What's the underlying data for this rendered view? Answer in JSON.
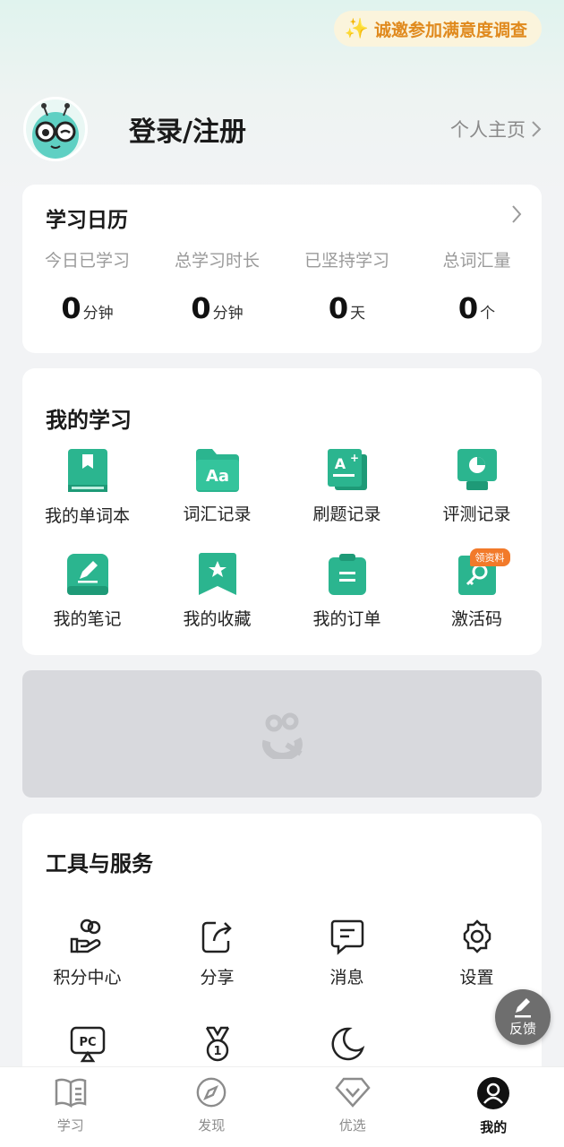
{
  "survey": {
    "label": "诚邀参加满意度调查",
    "icon": "sparkle-icon"
  },
  "profile": {
    "login_label": "登录/注册",
    "homepage_label": "个人主页"
  },
  "calendar": {
    "title": "学习日历",
    "stats": [
      {
        "label": "今日已学习",
        "value": "0",
        "unit": "分钟"
      },
      {
        "label": "总学习时长",
        "value": "0",
        "unit": "分钟"
      },
      {
        "label": "已坚持学习",
        "value": "0",
        "unit": "天"
      },
      {
        "label": "总词汇量",
        "value": "0",
        "unit": "个"
      }
    ]
  },
  "study": {
    "title": "我的学习",
    "items": [
      {
        "label": "我的单词本",
        "icon": "wordbook-icon"
      },
      {
        "label": "词汇记录",
        "icon": "vocab-folder-icon"
      },
      {
        "label": "刷题记录",
        "icon": "exercise-record-icon"
      },
      {
        "label": "评测记录",
        "icon": "assessment-icon"
      },
      {
        "label": "我的笔记",
        "icon": "notes-icon"
      },
      {
        "label": "我的收藏",
        "icon": "favorites-icon"
      },
      {
        "label": "我的订单",
        "icon": "orders-icon"
      },
      {
        "label": "激活码",
        "icon": "activation-key-icon",
        "badge": "领资料"
      }
    ]
  },
  "tools": {
    "title": "工具与服务",
    "items": [
      {
        "label": "积分中心",
        "icon": "points-icon"
      },
      {
        "label": "分享",
        "icon": "share-icon"
      },
      {
        "label": "消息",
        "icon": "message-icon"
      },
      {
        "label": "设置",
        "icon": "settings-icon"
      },
      {
        "label": "",
        "icon": "pc-icon"
      },
      {
        "label": "",
        "icon": "medal-icon"
      },
      {
        "label": "",
        "icon": "night-mode-icon"
      }
    ]
  },
  "feedback": {
    "label": "反馈",
    "icon": "edit-icon"
  },
  "tabs": [
    {
      "label": "学习",
      "icon": "book-icon"
    },
    {
      "label": "发现",
      "icon": "compass-icon"
    },
    {
      "label": "优选",
      "icon": "diamond-icon"
    },
    {
      "label": "我的",
      "icon": "user-icon",
      "active": true
    }
  ],
  "colors": {
    "accent": "#2bb58f",
    "survey_text": "#e08a1e",
    "badge": "#f27a2a"
  }
}
